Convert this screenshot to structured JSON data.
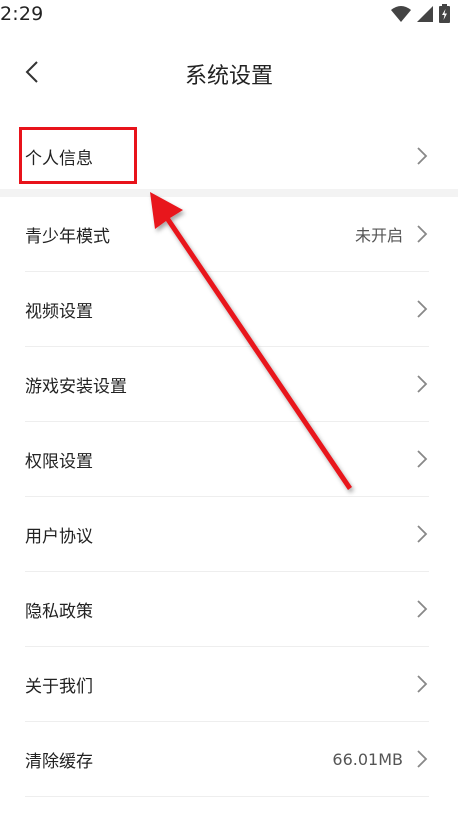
{
  "status_bar": {
    "time": "2:29",
    "icons": [
      "wifi-icon",
      "signal-icon",
      "battery-charging-icon"
    ]
  },
  "header": {
    "title": "系统设置",
    "back_icon": "chevron-left-icon"
  },
  "settings": {
    "items": [
      {
        "label": "个人信息",
        "value": ""
      },
      {
        "label": "青少年模式",
        "value": "未开启"
      },
      {
        "label": "视频设置",
        "value": ""
      },
      {
        "label": "游戏安装设置",
        "value": ""
      },
      {
        "label": "权限设置",
        "value": ""
      },
      {
        "label": "用户协议",
        "value": ""
      },
      {
        "label": "隐私政策",
        "value": ""
      },
      {
        "label": "关于我们",
        "value": ""
      },
      {
        "label": "清除缓存",
        "value": "66.01MB"
      }
    ]
  },
  "annotation": {
    "highlight_color": "#e8131b",
    "target": "个人信息"
  },
  "colors": {
    "text": "#222222",
    "secondary_text": "#555555",
    "chevron": "#888888",
    "divider": "#eeeeee",
    "section_gap": "#f3f3f3"
  }
}
